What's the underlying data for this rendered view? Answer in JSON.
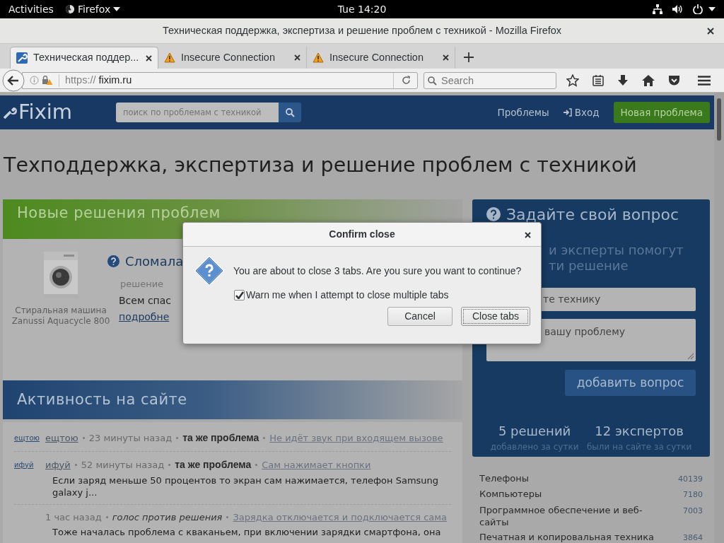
{
  "system_bar": {
    "activities": "Activities",
    "app": "Firefox",
    "clock": "Tue 14:20"
  },
  "window": {
    "title": "Техническая поддержка, экспертиза и решение проблем с техникой - Mozilla Firefox"
  },
  "tabs": [
    {
      "label": "Техническая поддер...",
      "selected": true,
      "kind": "site"
    },
    {
      "label": "Insecure Connection",
      "selected": false,
      "kind": "warning"
    },
    {
      "label": "Insecure Connection",
      "selected": false,
      "kind": "warning"
    }
  ],
  "address_bar": {
    "scheme": "https://",
    "domain": "fixim.ru"
  },
  "search": {
    "placeholder": "Search"
  },
  "site": {
    "logo": "Fixim",
    "search_placeholder": "поиск по проблемам с техникой",
    "nav": [
      {
        "label": "Проблемы",
        "kind": "link"
      },
      {
        "label": "Вход",
        "kind": "login"
      }
    ],
    "new_button": "Новая проблема",
    "heading": "Техподдержка, экспертиза и решение проблем с техникой"
  },
  "new_solutions": {
    "title": "Новые решения проблем",
    "item": {
      "kind": "picture",
      "caption": "Стиральная машина Zanussi Aquacycle 800",
      "title": "Сломала",
      "meta": "решение",
      "text": "Всем спас",
      "link": "подробне"
    }
  },
  "activity": {
    "title": "Активность на сайте",
    "rows": [
      {
        "kind": "same",
        "avatar": "ещтою",
        "user": "ещтою",
        "time": "23 минуты назад",
        "action": "та же проблема",
        "link": "Не идёт звук при входящем вызове"
      },
      {
        "kind": "same",
        "avatar": "ифуй",
        "user": "ифуй",
        "time": "52 минуты назад",
        "action": "та же проблема",
        "link": "Сам нажимает кнопки",
        "text": "Если заряд меньше 50 процентов то экран сам нажимается, телефон Samsung galaxy j..."
      },
      {
        "kind": "vote",
        "time": "1 час назад",
        "action": "голос против решения",
        "link": "Зарядка отключается и подключается сама",
        "text": "Тоже началась проблема с кваканьем, при включении зарядки смартфона, она"
      }
    ]
  },
  "ask_panel": {
    "title": "Задайте свой вопрос",
    "subtitle_lines": [
      "и эксперты помогут",
      "ти решение"
    ],
    "device_field": "те технику",
    "problem_field": "вашу проблему",
    "button": "добавить вопрос",
    "stats": [
      {
        "value": "5 решений",
        "caption": "добавлено за сутки"
      },
      {
        "value": "12 экспертов",
        "caption": "были на сайте за сутки"
      }
    ]
  },
  "categories": [
    {
      "name": "Телефоны",
      "count": "40139"
    },
    {
      "name": "Компьютеры",
      "count": "7180"
    },
    {
      "name": "Программное обеспечение и веб-сайты",
      "count": "7003"
    },
    {
      "name": "Печатная и копировальная техника",
      "count": "3864"
    }
  ],
  "dialog": {
    "title": "Confirm close",
    "message": "You are about to close 3 tabs. Are you sure you want to continue?",
    "checkbox": {
      "label": "Warn me when I attempt to close multiple tabs",
      "checked": true
    },
    "buttons": [
      {
        "label": "Cancel",
        "focused": false
      },
      {
        "label": "Close tabs",
        "focused": true
      }
    ]
  }
}
